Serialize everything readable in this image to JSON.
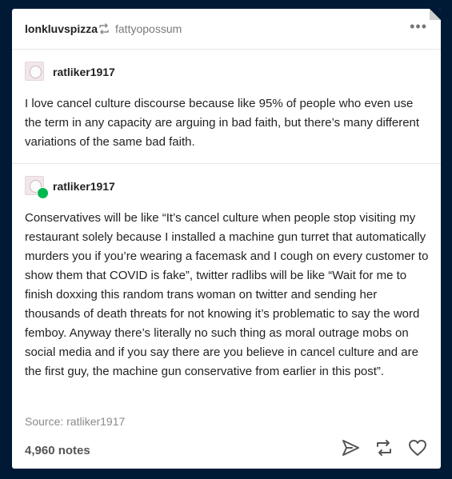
{
  "post": {
    "blog_name": "lonkluvspizza",
    "reblog_icon": "reblog-icon",
    "reblogged_from": "fattyopossum",
    "more_label": "•••"
  },
  "entries": [
    {
      "username": "ratliker1917",
      "text": "I love cancel culture discourse because like 95% of people who even use the term in any capacity are arguing in bad faith, but there’s many different variations of the same bad faith."
    },
    {
      "username": "ratliker1917",
      "text": "Conservatives will be like “It’s cancel culture when people stop visiting my restaurant solely because I installed a machine gun turret that automatically murders you if you’re wearing a facemask and I cough on every customer to show them that COVID is fake”, twitter radlibs will be like “Wait for me to finish doxxing this random trans woman on twitter and sending her thousands of death threats for not knowing it’s problematic to say the word femboy. Anyway there’s literally no such thing as moral outrage mobs on social media and if you say there are you believe in cancel culture and are the first guy, the machine gun conservative from earlier in this post”."
    }
  ],
  "footer": {
    "source_label": "Source:",
    "source_name": "ratliker1917",
    "notes": "4,960 notes",
    "icons": [
      "share-icon",
      "reblog-icon",
      "like-icon"
    ]
  },
  "colors": {
    "background": "#001935",
    "card": "#ffffff",
    "text": "#222222",
    "muted": "#7a7a7a",
    "reblog_badge": "#00b850"
  }
}
